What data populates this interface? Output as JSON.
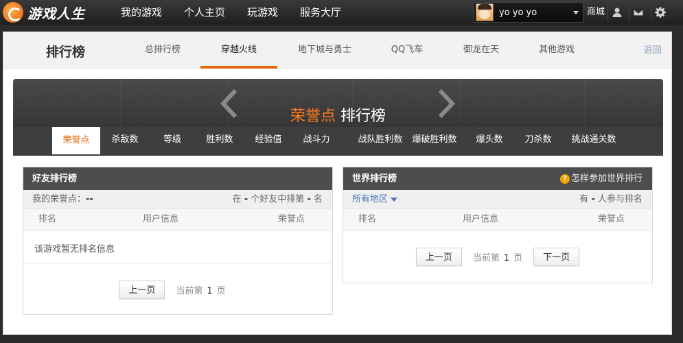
{
  "topbar": {
    "logo_text": "游戏人生",
    "nav": [
      "我的游戏",
      "个人主页",
      "玩游戏",
      "服务大厅"
    ],
    "user_name": "yo yo yo",
    "shop": "商城",
    "icons": [
      "user-icon",
      "mail-icon",
      "gear-icon"
    ]
  },
  "subnav": {
    "title": "排行榜",
    "tabs": [
      "总排行榜",
      "穿越火线",
      "地下城与勇士",
      "QQ飞车",
      "御龙在天",
      "其他游戏"
    ],
    "active": "穿越火线",
    "back": "返回"
  },
  "banner": {
    "title_highlight": "荣誉点",
    "title_rest": " 排行榜",
    "tabs": [
      "荣誉点",
      "杀敌数",
      "等级",
      "胜利数",
      "经验值",
      "战斗力",
      "战队胜利数",
      "爆破胜利数",
      "爆头数",
      "刀杀数",
      "挑战通关数"
    ],
    "active": "荣誉点"
  },
  "friends": {
    "title": "好友排行榜",
    "my_points_label": "我的荣誉点：",
    "my_points_value": "--",
    "rank_prefix": "在",
    "rank_value_1": "-",
    "rank_mid": "个好友中排第",
    "rank_value_2": "-",
    "rank_suffix": "名",
    "col_rank": "排名",
    "col_user": "用户信息",
    "col_points": "荣誉点",
    "empty": "该游戏暂无排名信息",
    "prev": "上一页",
    "page_prefix": "当前第",
    "page": "1",
    "page_suffix": "页"
  },
  "world": {
    "title": "世界排行榜",
    "help": "怎样参加世界排行",
    "region": "所有地区",
    "count_prefix": "有",
    "count_value": "-",
    "count_suffix": "人参与排名",
    "col_rank": "排名",
    "col_user": "用户信息",
    "col_points": "荣誉点",
    "prev": "上一页",
    "page_prefix": "当前第",
    "page": "1",
    "page_suffix": "页",
    "next": "下一页"
  },
  "colors": {
    "accent": "#e8650c",
    "header_dark": "#4d4d4d",
    "link": "#4a78b8"
  }
}
